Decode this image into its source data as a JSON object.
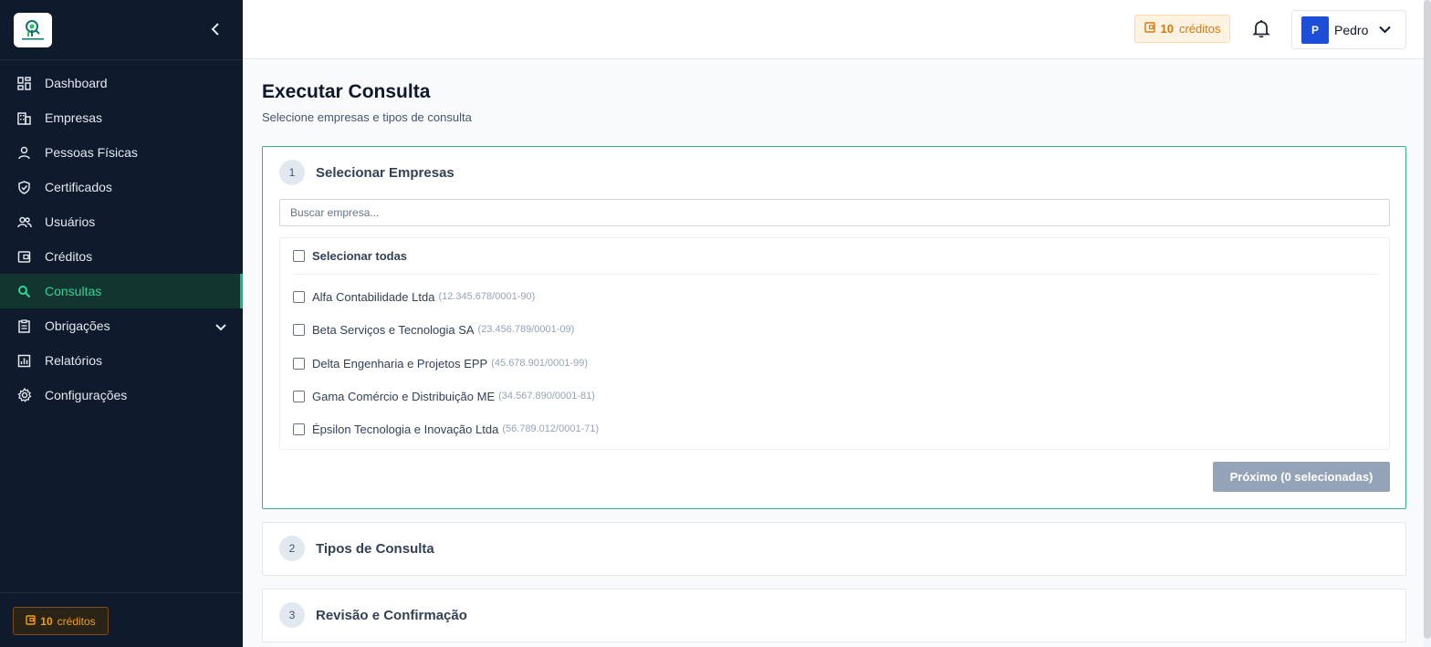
{
  "sidebar": {
    "items": [
      {
        "label": "Dashboard",
        "icon": "dashboard-icon"
      },
      {
        "label": "Empresas",
        "icon": "building-icon"
      },
      {
        "label": "Pessoas Físicas",
        "icon": "person-icon"
      },
      {
        "label": "Certificados",
        "icon": "shield-check-icon"
      },
      {
        "label": "Usuários",
        "icon": "users-icon"
      },
      {
        "label": "Créditos",
        "icon": "wallet-icon"
      },
      {
        "label": "Consultas",
        "icon": "search-icon",
        "active": true
      },
      {
        "label": "Obrigações",
        "icon": "clipboard-icon",
        "expandable": true
      },
      {
        "label": "Relatórios",
        "icon": "chart-icon"
      },
      {
        "label": "Configurações",
        "icon": "gear-icon"
      }
    ],
    "credits": {
      "amount": "10",
      "label": "créditos"
    }
  },
  "topbar": {
    "credits": {
      "amount": "10",
      "label": "créditos"
    },
    "user": {
      "initial": "P",
      "name": "Pedro"
    }
  },
  "page": {
    "title": "Executar Consulta",
    "subtitle": "Selecione empresas e tipos de consulta"
  },
  "steps": [
    {
      "num": "1",
      "title": "Selecionar Empresas"
    },
    {
      "num": "2",
      "title": "Tipos de Consulta"
    },
    {
      "num": "3",
      "title": "Revisão e Confirmação"
    }
  ],
  "step1": {
    "search_placeholder": "Buscar empresa...",
    "select_all": "Selecionar todas",
    "companies": [
      {
        "name": "Alfa Contabilidade Ltda",
        "doc": "(12.345.678/0001-90)"
      },
      {
        "name": "Beta Serviços e Tecnologia SA",
        "doc": "(23.456.789/0001-09)"
      },
      {
        "name": "Delta Engenharia e Projetos EPP",
        "doc": "(45.678.901/0001-99)"
      },
      {
        "name": "Gama Comércio e Distribuição ME",
        "doc": "(34.567.890/0001-81)"
      },
      {
        "name": "Épsilon Tecnologia e Inovação Ltda",
        "doc": "(56.789.012/0001-71)"
      }
    ],
    "next_label": "Próximo (0 selecionadas)"
  },
  "colors": {
    "sidebar_bg": "#0f1b2d",
    "accent": "#10b981",
    "credit": "#d97706",
    "avatar": "#1d4ed8"
  }
}
